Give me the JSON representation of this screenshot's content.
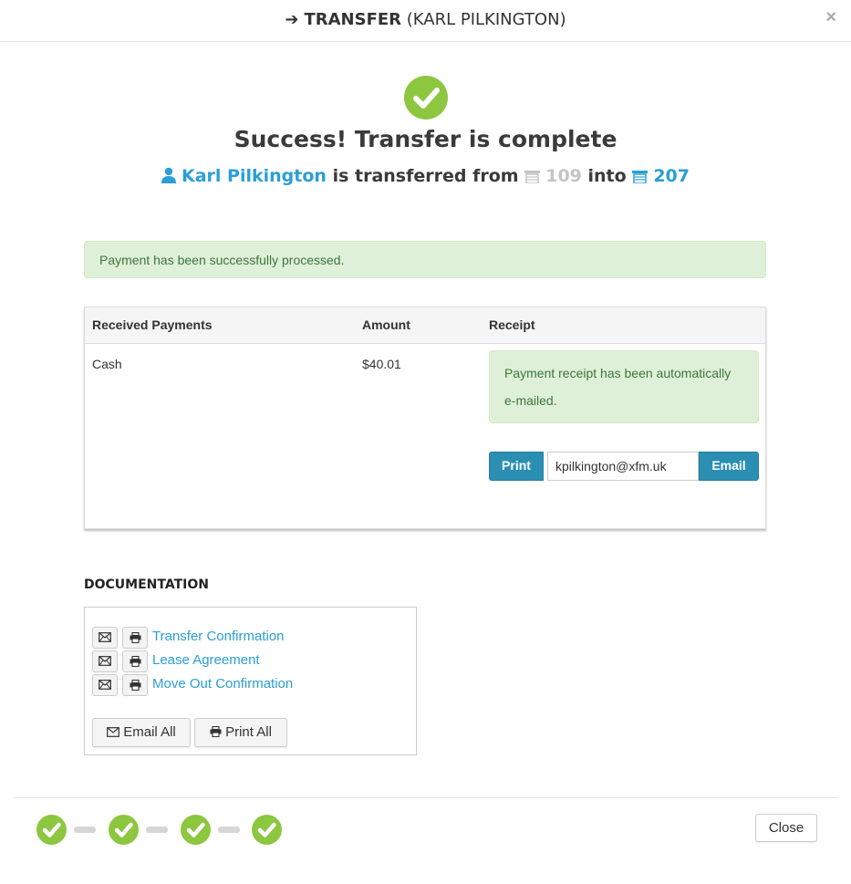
{
  "header": {
    "title_main": "TRANSFER",
    "title_sub": "(KARL PILKINGTON)",
    "arrow_icon": "arrow-right-icon",
    "close_symbol": "×"
  },
  "success": {
    "headline": "Success! Transfer is complete",
    "tenant_name": "Karl Pilkington",
    "phrase_from": "is transferred from",
    "from_unit": "109",
    "phrase_into": "into",
    "to_unit": "207"
  },
  "payment_alert": "Payment has been successfully processed.",
  "payments_table": {
    "headers": [
      "Received Payments",
      "Amount",
      "Receipt"
    ],
    "rows": [
      {
        "method": "Cash",
        "amount": "$40.01"
      }
    ],
    "receipt_message": "Payment receipt has been automatically e-mailed.",
    "print_label": "Print",
    "email_value": "kpilkington@xfm.uk",
    "email_label": "Email"
  },
  "documentation": {
    "title": "DOCUMENTATION",
    "items": [
      {
        "label": "Transfer Confirmation"
      },
      {
        "label": "Lease Agreement"
      },
      {
        "label": "Move Out Confirmation"
      }
    ],
    "email_all_label": "Email All",
    "print_all_label": "Print All"
  },
  "steps": {
    "count": 4,
    "completed": 4
  },
  "footer": {
    "close_label": "Close"
  },
  "colors": {
    "success_green": "#8dc63f",
    "link_blue": "#2a9fd6",
    "button_blue": "#2b8fb4",
    "alert_bg": "#dff0d8",
    "alert_text": "#3c763d"
  }
}
